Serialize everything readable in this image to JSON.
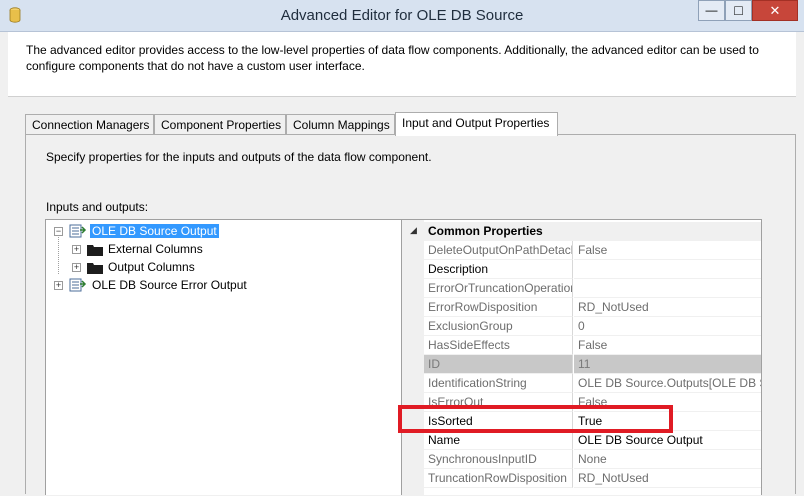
{
  "window": {
    "title": "Advanced Editor for OLE DB Source",
    "controls": {
      "minimize": "—",
      "maximize": "□",
      "close": "✕"
    },
    "icon": "database-icon"
  },
  "description": "The advanced editor provides access to the low-level properties of data flow components. Additionally, the advanced editor can be used to configure components that do not have a custom user interface.",
  "tabs": [
    {
      "label": "Connection Managers"
    },
    {
      "label": "Component Properties"
    },
    {
      "label": "Column Mappings"
    },
    {
      "label": "Input and Output Properties",
      "active": true
    }
  ],
  "panel": {
    "description": "Specify properties for the inputs and outputs of the data flow component.",
    "io_label": "Inputs and outputs:"
  },
  "tree": {
    "nodes": [
      {
        "label": "OLE DB Source Output",
        "expander": "−",
        "selected": true,
        "icon": "output-icon"
      },
      {
        "label": "External Columns",
        "expander": "+",
        "icon": "folder-icon"
      },
      {
        "label": "Output Columns",
        "expander": "+",
        "icon": "folder-icon"
      },
      {
        "label": "OLE DB Source Error Output",
        "expander": "+",
        "icon": "output-icon"
      }
    ]
  },
  "properties": {
    "category": "Common Properties",
    "collapse_glyph": "◢",
    "rows": [
      {
        "name": "DeleteOutputOnPathDetach",
        "value": "False"
      },
      {
        "name": "Description",
        "value": ""
      },
      {
        "name": "ErrorOrTruncationOperation",
        "value": ""
      },
      {
        "name": "ErrorRowDisposition",
        "value": "RD_NotUsed"
      },
      {
        "name": "ExclusionGroup",
        "value": "0"
      },
      {
        "name": "HasSideEffects",
        "value": "False"
      },
      {
        "name": "ID",
        "value": "11"
      },
      {
        "name": "IdentificationString",
        "value": "OLE DB Source.Outputs[OLE DB Source Output]"
      },
      {
        "name": "IsErrorOut",
        "value": "False"
      },
      {
        "name": "IsSorted",
        "value": "True"
      },
      {
        "name": "Name",
        "value": "OLE DB Source Output"
      },
      {
        "name": "SynchronousInputID",
        "value": "None"
      },
      {
        "name": "TruncationRowDisposition",
        "value": "RD_NotUsed"
      }
    ]
  },
  "colors": {
    "selection": "#3399ff",
    "highlight_box": "#e01b24",
    "close_button": "#c7463a"
  }
}
